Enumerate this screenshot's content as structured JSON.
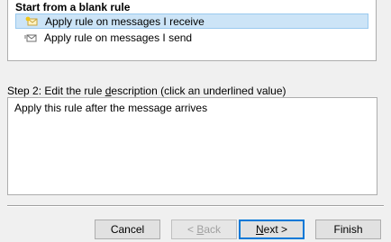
{
  "rule_list": {
    "group_header": "Start from a blank rule",
    "items": [
      {
        "label": "Apply rule on messages I receive",
        "selected": true,
        "icon": "envelope-receive-icon"
      },
      {
        "label": "Apply rule on messages I send",
        "selected": false,
        "icon": "envelope-send-icon"
      }
    ]
  },
  "step2": {
    "label_prefix": "Step 2: Edit the rule ",
    "label_underlined": "d",
    "label_rest": "escription (click an underlined value)",
    "description_text": "Apply this rule after the message arrives"
  },
  "buttons": {
    "cancel": "Cancel",
    "back_prefix": "< ",
    "back_mnemonic": "B",
    "back_rest": "ack",
    "next_mnemonic": "N",
    "next_rest": "ext >",
    "finish": "Finish"
  },
  "colors": {
    "selection_bg": "#cce4f7",
    "selection_border": "#99c9ef",
    "default_button_border": "#0078d7",
    "disabled_text": "#a0a0a0"
  }
}
